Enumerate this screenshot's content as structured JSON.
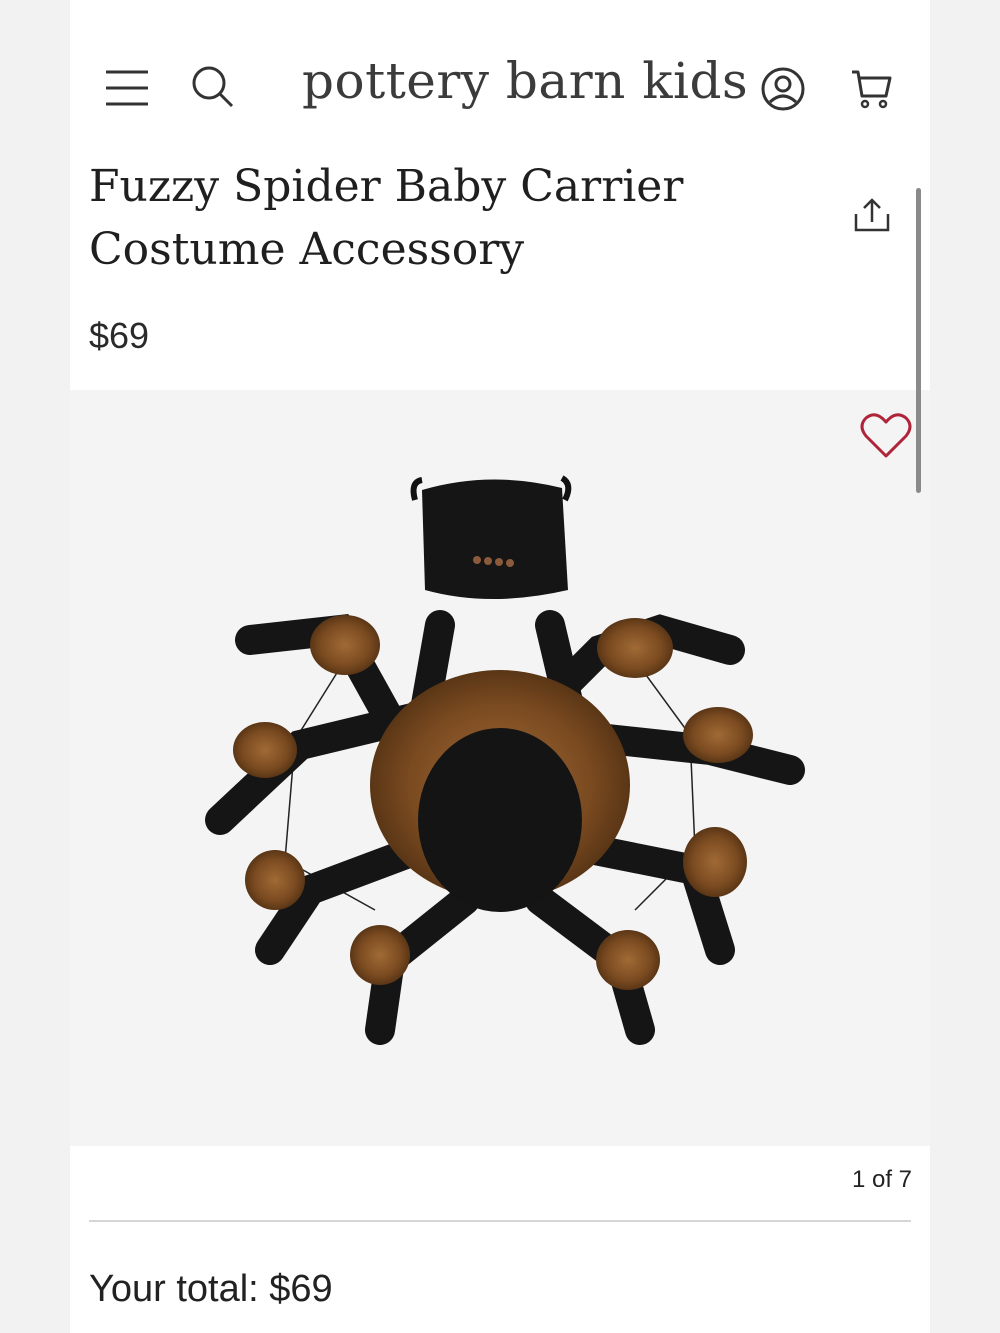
{
  "header": {
    "brand": "pottery barn kids",
    "icons": [
      "menu-icon",
      "search-icon",
      "account-icon",
      "cart-icon"
    ]
  },
  "product": {
    "title": "Fuzzy Spider Baby Carrier Costume Accessory",
    "price": "$69",
    "image_alt": "Fuzzy black and brown spider baby carrier costume with matching hat",
    "image_counter": "1 of 7"
  },
  "actions": {
    "share_icon": "share-icon",
    "favorite_icon": "heart-icon"
  },
  "footer": {
    "total_label": "Your total: $69"
  },
  "colors": {
    "heart": "#b0243a",
    "text": "#222222",
    "fur": "#8b5a2b",
    "body": "#141414"
  }
}
